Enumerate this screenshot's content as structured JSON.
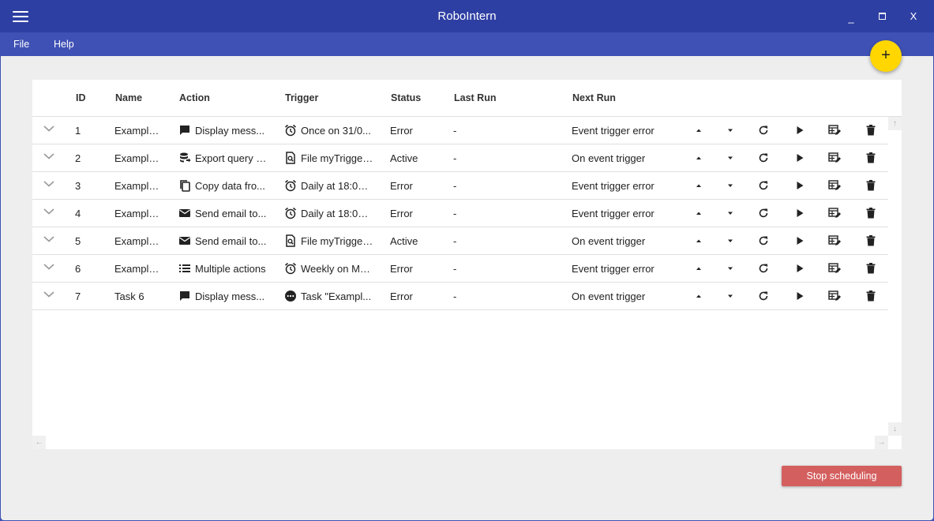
{
  "app": {
    "title": "RoboIntern"
  },
  "window": {
    "minimize": "_",
    "close": "X"
  },
  "menu": {
    "items": [
      "File",
      "Help"
    ]
  },
  "fab": {
    "label": "+"
  },
  "table": {
    "headers": [
      "ID",
      "Name",
      "Action",
      "Trigger",
      "Status",
      "Last Run",
      "Next Run"
    ],
    "rows": [
      {
        "id": "1",
        "name": "Example:...",
        "action": "Display mess...",
        "action_icon": "message-icon",
        "trigger": "Once on 31/0...",
        "trigger_icon": "alarm-icon",
        "status": "Error",
        "last_run": "-",
        "next_run": "Event trigger error"
      },
      {
        "id": "2",
        "name": "Example:...",
        "action": "Export query fr...",
        "action_icon": "database-export-icon",
        "trigger": "File myTrigger...",
        "trigger_icon": "file-search-icon",
        "status": "Active",
        "last_run": "-",
        "next_run": "On event trigger"
      },
      {
        "id": "3",
        "name": "Example:...",
        "action": "Copy data fro...",
        "action_icon": "copy-icon",
        "trigger": "Daily at 18:00:...",
        "trigger_icon": "alarm-icon",
        "status": "Error",
        "last_run": "-",
        "next_run": "Event trigger error"
      },
      {
        "id": "4",
        "name": "Example:...",
        "action": "Send email to...",
        "action_icon": "email-icon",
        "trigger": "Daily at 18:00:...",
        "trigger_icon": "alarm-icon",
        "status": "Error",
        "last_run": "-",
        "next_run": "Event trigger error"
      },
      {
        "id": "5",
        "name": "Example:...",
        "action": "Send email to...",
        "action_icon": "email-icon",
        "trigger": "File myTrigger...",
        "trigger_icon": "file-search-icon",
        "status": "Active",
        "last_run": "-",
        "next_run": "On event trigger"
      },
      {
        "id": "6",
        "name": "Example:...",
        "action": "Multiple actions",
        "action_icon": "list-icon",
        "trigger": "Weekly on Mo...",
        "trigger_icon": "alarm-icon",
        "status": "Error",
        "last_run": "-",
        "next_run": "Event trigger error"
      },
      {
        "id": "7",
        "name": "Task 6",
        "action": "Display mess...",
        "action_icon": "message-icon",
        "trigger": "Task \"Exampl...",
        "trigger_icon": "more-circle-icon",
        "status": "Error",
        "last_run": "-",
        "next_run": "On event trigger"
      }
    ]
  },
  "footer": {
    "stop_label": "Stop scheduling"
  },
  "colors": {
    "titlebar": "#2e3fa3",
    "menubar": "#3f51b5",
    "fab": "#ffd600",
    "stop": "#d45f5f",
    "content_bg": "#eeeeee"
  }
}
